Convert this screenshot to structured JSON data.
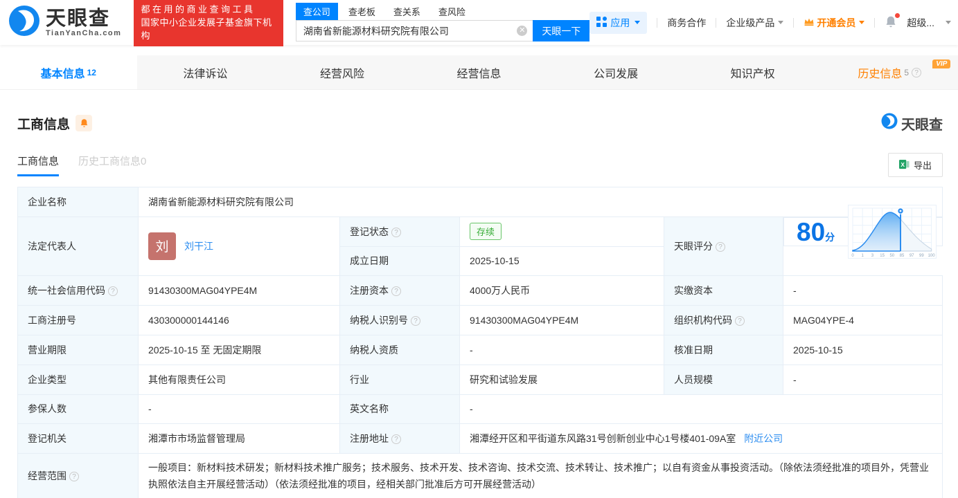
{
  "brand": {
    "name": "天眼查",
    "domain": "TianYanCha.com",
    "watermark": "天眼查",
    "primary_color": "#0084ff",
    "orange": "#ff8000",
    "red": "#e8352e"
  },
  "slogan": {
    "line1": "都在用的商业查询工具",
    "line2": "国家中小企业发展子基金旗下机构"
  },
  "search": {
    "tabs": [
      {
        "label": "查公司"
      },
      {
        "label": "查老板"
      },
      {
        "label": "查关系"
      },
      {
        "label": "查风险"
      }
    ],
    "value": "湖南省新能源材料研究院有限公司",
    "button_label": "天眼一下"
  },
  "nav": {
    "apps": "应用",
    "cooperation": "商务合作",
    "enterprise_products": "企业级产品",
    "vip": "开通会员",
    "user": "超级...",
    "vip_badge": "VIP"
  },
  "tabbar": {
    "tabs": [
      {
        "label": "基本信息",
        "count": "12"
      },
      {
        "label": "法律诉讼",
        "count": ""
      },
      {
        "label": "经营风险",
        "count": ""
      },
      {
        "label": "经营信息",
        "count": ""
      },
      {
        "label": "公司发展",
        "count": ""
      },
      {
        "label": "知识产权",
        "count": ""
      },
      {
        "label": "历史信息",
        "count": "5"
      }
    ]
  },
  "section": {
    "title": "工商信息",
    "subtab_active": "工商信息",
    "subtab_history": "历史工商信息0",
    "export_label": "导出"
  },
  "table": {
    "company_name_label": "企业名称",
    "company_name": "湖南省新能源材料研究院有限公司",
    "legal_rep_label": "法定代表人",
    "legal_rep_initial": "刘",
    "legal_rep_name": "刘干江",
    "reg_status_label": "登记状态",
    "reg_status_value": "存续",
    "est_date_label": "成立日期",
    "est_date_value": "2025-10-15",
    "score_label": "天眼评分",
    "score_value": "80",
    "score_unit": "分",
    "score_axis": [
      "0",
      "1",
      "3",
      "15",
      "50",
      "85",
      "97",
      "99",
      "100"
    ],
    "credit_code_label": "统一社会信用代码",
    "credit_code_value": "91430300MAG04YPE4M",
    "reg_capital_label": "注册资本",
    "reg_capital_value": "4000万人民币",
    "paid_capital_label": "实缴资本",
    "paid_capital_value": "-",
    "reg_number_label": "工商注册号",
    "reg_number_value": "430300000144146",
    "taxpayer_id_label": "纳税人识别号",
    "taxpayer_id_value": "91430300MAG04YPE4M",
    "org_code_label": "组织机构代码",
    "org_code_value": "MAG04YPE-4",
    "business_term_label": "营业期限",
    "business_term_value": "2025-10-15 至 无固定期限",
    "taxpayer_quality_label": "纳税人资质",
    "taxpayer_quality_value": "-",
    "approval_date_label": "核准日期",
    "approval_date_value": "2025-10-15",
    "company_type_label": "企业类型",
    "company_type_value": "其他有限责任公司",
    "industry_label": "行业",
    "industry_value": "研究和试验发展",
    "staff_size_label": "人员规模",
    "staff_size_value": "-",
    "insured_label": "参保人数",
    "insured_value": "-",
    "english_name_label": "英文名称",
    "english_name_value": "-",
    "reg_authority_label": "登记机关",
    "reg_authority_value": "湘潭市市场监督管理局",
    "address_label": "注册地址",
    "address_value": "湘潭经开区和平街道东风路31号创新创业中心1号楼401-09A室",
    "nearby_link": "附近公司",
    "scope_label": "经营范围",
    "scope_value": "一般项目：新材料技术研发；新材料技术推广服务；技术服务、技术开发、技术咨询、技术交流、技术转让、技术推广；以自有资金从事投资活动。（除依法须经批准的项目外，凭营业执照依法自主开展经营活动）（依法须经批准的项目，经相关部门批准后方可开展经营活动）"
  }
}
